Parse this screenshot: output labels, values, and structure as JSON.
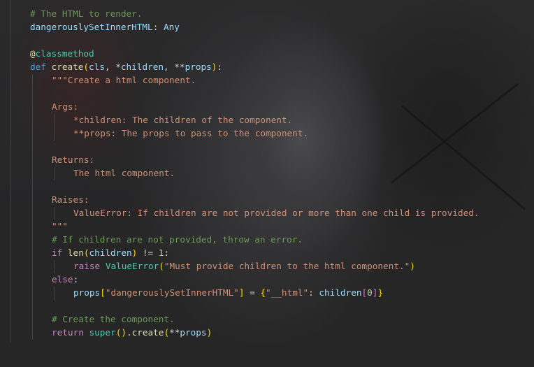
{
  "colors": {
    "comment": "#6a9955",
    "keyword": "#569cd6",
    "control": "#c586c0",
    "function": "#dcdcaa",
    "class": "#4ec9b0",
    "variable": "#9cdcfe",
    "string": "#ce9178",
    "number": "#b5cea8"
  },
  "code": {
    "l1": "# The HTML to render.",
    "l2_name": "dangerouslySetInnerHTML",
    "l2_sep": ": ",
    "l2_type": "Any",
    "l4_at": "@",
    "l4_name": "classmethod",
    "l5_def": "def",
    "l5_fn": "create",
    "l5_open": "(",
    "l5_cls": "cls",
    "l5_sep1": ", *",
    "l5_children": "children",
    "l5_sep2": ", **",
    "l5_props": "props",
    "l5_close": ")",
    "l5_colon": ":",
    "l6": "\"\"\"Create a html component.",
    "l8": "Args:",
    "l9": "*children: The children of the component.",
    "l10": "**props: The props to pass to the component.",
    "l12": "Returns:",
    "l13": "The html component.",
    "l15": "Raises:",
    "l16": "ValueError: If children are not provided or more than one child is provided.",
    "l17": "\"\"\"",
    "l18": "# If children are not provided, throw an error.",
    "l19_if": "if",
    "l19_len": "len",
    "l19_open": "(",
    "l19_children": "children",
    "l19_close": ")",
    "l19_op": " != ",
    "l19_num": "1",
    "l19_colon": ":",
    "l20_raise": "raise",
    "l20_cls": "ValueError",
    "l20_open": "(",
    "l20_str": "\"Must provide children to the html component.\"",
    "l20_close": ")",
    "l21_else": "else",
    "l21_colon": ":",
    "l22_props": "props",
    "l22_open": "[",
    "l22_key": "\"dangerouslySetInnerHTML\"",
    "l22_close": "]",
    "l22_eq": " = ",
    "l22_bopen": "{",
    "l22_hkey": "\"__html\"",
    "l22_colon": ": ",
    "l22_children": "children",
    "l22_iopen": "[",
    "l22_idx": "0",
    "l22_iclose": "]",
    "l22_bclose": "}",
    "l24": "# Create the component.",
    "l25_return": "return",
    "l25_super": "super",
    "l25_p1": "()",
    "l25_dot": ".",
    "l25_create": "create",
    "l25_open": "(",
    "l25_stars": "**",
    "l25_props": "props",
    "l25_close": ")"
  }
}
